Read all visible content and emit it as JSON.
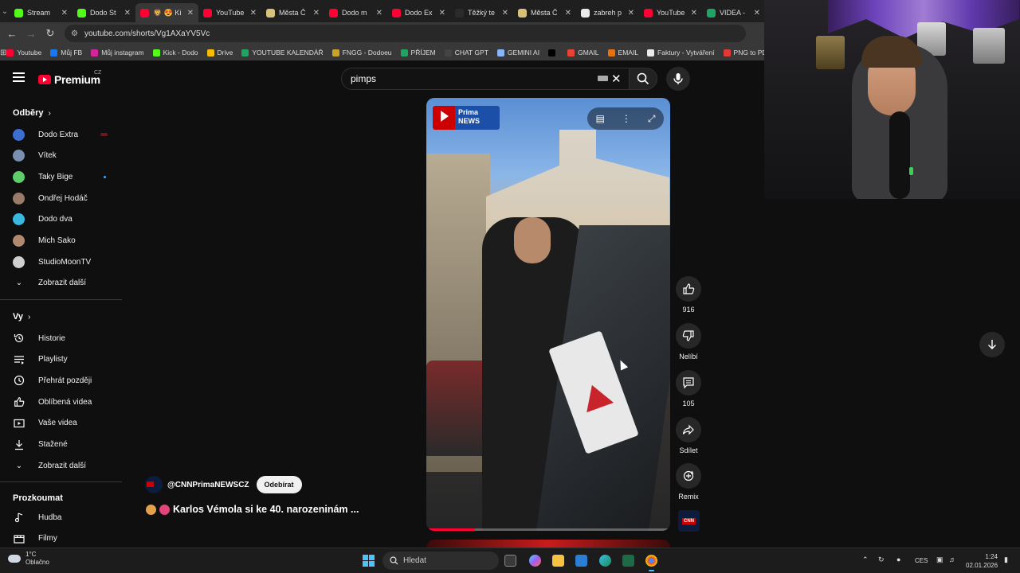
{
  "browser": {
    "tabs": [
      {
        "title": "Stream",
        "color": "#53fc18"
      },
      {
        "title": "Dodo St",
        "color": "#53fc18"
      },
      {
        "title": "🦁 😍 Ki",
        "color": "#ff0033",
        "active": true
      },
      {
        "title": "YouTube",
        "color": "#ff0033"
      },
      {
        "title": "Města Č",
        "color": "#d6c27a"
      },
      {
        "title": "Dodo m",
        "color": "#ff0033"
      },
      {
        "title": "Dodo Ex",
        "color": "#ff0033"
      },
      {
        "title": "Těžký te",
        "color": "#2b2b2b"
      },
      {
        "title": "Města Č",
        "color": "#d6c27a"
      },
      {
        "title": "zabreh p",
        "color": "#e8eaed"
      },
      {
        "title": "YouTube",
        "color": "#ff0033"
      },
      {
        "title": "VIDEA -",
        "color": "#1fa463"
      }
    ],
    "url": "youtube.com/shorts/Vg1AXaYV5Vc",
    "bookmarks": [
      {
        "label": "Youtube",
        "color": "#ff0033"
      },
      {
        "label": "Můj FB",
        "color": "#1877f2"
      },
      {
        "label": "Můj instagram",
        "color": "#d6249f"
      },
      {
        "label": "Kick - Dodo",
        "color": "#53fc18"
      },
      {
        "label": "Drive",
        "color": "#fbbc04"
      },
      {
        "label": "YOUTUBE KALENDÁŘ",
        "color": "#1fa463"
      },
      {
        "label": "FNGG - Dodoeu",
        "color": "#c9a227"
      },
      {
        "label": "PŘÍJEM",
        "color": "#1fa463"
      },
      {
        "label": "CHAT GPT",
        "color": "#444444"
      },
      {
        "label": "GEMINI AI",
        "color": "#8ab4f8"
      },
      {
        "label": "",
        "color": "#000000"
      },
      {
        "label": "GMAIL",
        "color": "#ea4335"
      },
      {
        "label": "EMAIL",
        "color": "#e8710a"
      },
      {
        "label": "Faktury - Vytváření",
        "color": "#e8eaed"
      },
      {
        "label": "PNG to PDF",
        "color": "#e53935"
      }
    ]
  },
  "youtube": {
    "logo": "Premium",
    "logo_country": "CZ",
    "search_value": "pimps",
    "sidebar": {
      "subscriptions_title": "Odběry",
      "channels": [
        {
          "name": "Dodo Extra",
          "color": "#3d6fd1",
          "badge": "live"
        },
        {
          "name": "Vítek",
          "color": "#7b8fb0"
        },
        {
          "name": "Taky Bige",
          "color": "#5ccf6b",
          "badge": "dot"
        },
        {
          "name": "Ondřej Hodáč",
          "color": "#9a7a68"
        },
        {
          "name": "Dodo dva",
          "color": "#3bb8e0"
        },
        {
          "name": "Mich Sako",
          "color": "#b08a70"
        },
        {
          "name": "StudioMoonTV",
          "color": "#cfcfcf"
        }
      ],
      "show_more": "Zobrazit další",
      "you_title": "Vy",
      "you_items": [
        {
          "label": "Historie",
          "icon": "history-icon"
        },
        {
          "label": "Playlisty",
          "icon": "playlists-icon"
        },
        {
          "label": "Přehrát později",
          "icon": "watch-later-icon"
        },
        {
          "label": "Oblíbená videa",
          "icon": "liked-videos-icon"
        },
        {
          "label": "Vaše videa",
          "icon": "your-videos-icon"
        },
        {
          "label": "Stažené",
          "icon": "downloads-icon"
        }
      ],
      "show_more_2": "Zobrazit další",
      "explore_title": "Prozkoumat",
      "explore_items": [
        {
          "label": "Hudba",
          "icon": "music-icon"
        },
        {
          "label": "Filmy",
          "icon": "movies-icon"
        }
      ]
    },
    "short": {
      "watermark_brand": "Prima",
      "watermark_sub": "NEWS",
      "channel": "@CNNPrimaNEWSCZ",
      "subscribe_label": "Odebírat",
      "title": "Karlos Vémola si ke 40. narozeninám ...",
      "progress": 0.2,
      "actions": {
        "likes": "916",
        "dislike_label": "Nelíbí",
        "comments": "105",
        "share_label": "Sdílet",
        "remix_label": "Remix"
      },
      "channel_thumb_text": "CNN"
    }
  },
  "taskbar": {
    "weather_temp": "1°C",
    "weather_desc": "Oblačno",
    "search_placeholder": "Hledat",
    "language": "CES",
    "time": "1:24",
    "date": "02.01.2026"
  }
}
